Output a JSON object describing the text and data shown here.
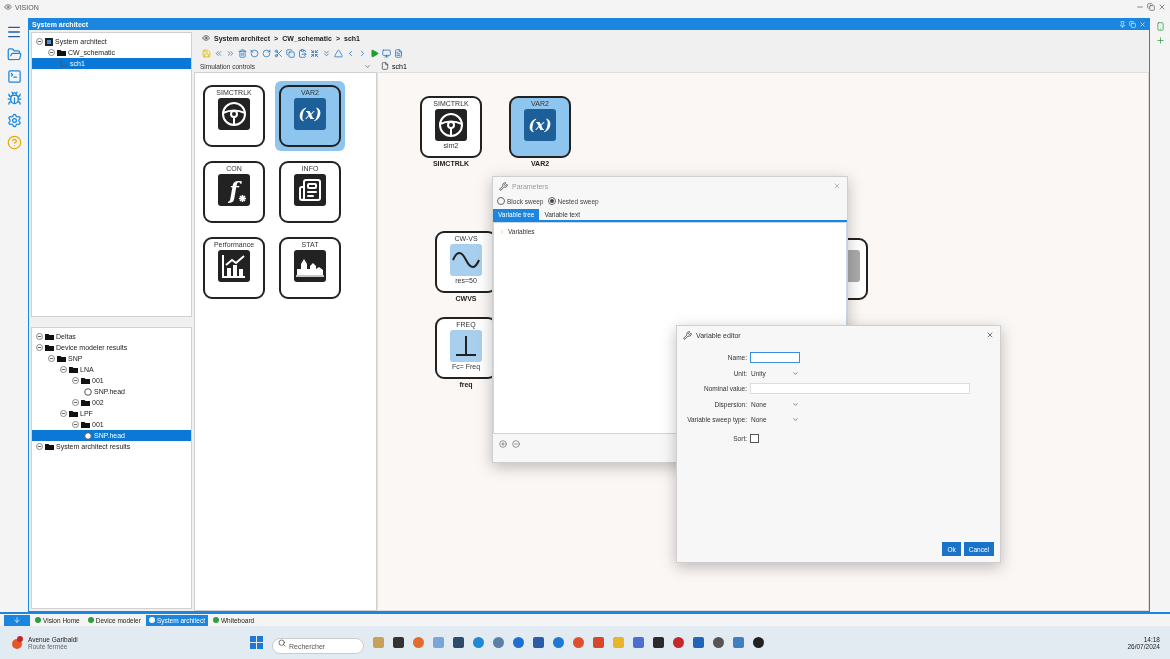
{
  "app": {
    "title": "VISION"
  },
  "window": {
    "title": "System architect"
  },
  "project_tree": [
    {
      "label": "System architect",
      "kind": "project",
      "selected": false,
      "children": [
        {
          "label": "CW_schematic",
          "kind": "folder",
          "selected": false,
          "children": [
            {
              "label": "sch1",
              "kind": "sheet",
              "selected": true
            }
          ]
        }
      ]
    }
  ],
  "results_tree": [
    {
      "label": "Deltas",
      "kind": "folder",
      "selected": false
    },
    {
      "label": "Device modeler results",
      "kind": "folder",
      "selected": false,
      "children": [
        {
          "label": "SNP",
          "kind": "folder",
          "selected": false,
          "children": [
            {
              "label": "LNA",
              "kind": "folder",
              "selected": false,
              "children": [
                {
                  "label": "001",
                  "kind": "folder",
                  "selected": false,
                  "children": [
                    {
                      "label": "SNP.head",
                      "kind": "file",
                      "selected": false
                    }
                  ]
                },
                {
                  "label": "002",
                  "kind": "folder",
                  "selected": false
                }
              ]
            },
            {
              "label": "LPF",
              "kind": "folder",
              "selected": false,
              "children": [
                {
                  "label": "001",
                  "kind": "folder",
                  "selected": false,
                  "children": [
                    {
                      "label": "SNP.head",
                      "kind": "file",
                      "selected": true
                    }
                  ]
                }
              ]
            }
          ]
        }
      ]
    },
    {
      "label": "System architect results",
      "kind": "folder",
      "selected": false
    }
  ],
  "breadcrumb": {
    "items": [
      "System architect",
      "CW_schematic",
      "sch1"
    ],
    "separator": ">"
  },
  "palette": {
    "category": "Simulation controls",
    "items": [
      {
        "label": "SIMCTRLK",
        "kind": "steering",
        "selected": false
      },
      {
        "label": "VAR2",
        "kind": "variable",
        "symbol": "(x)",
        "selected": true
      },
      {
        "label": "CON",
        "kind": "function",
        "symbol": "f",
        "selected": false
      },
      {
        "label": "INFO",
        "kind": "info",
        "selected": false
      },
      {
        "label": "Performance",
        "kind": "chart",
        "selected": false
      },
      {
        "label": "STAT",
        "kind": "stat",
        "selected": false
      }
    ]
  },
  "canvas": {
    "tab": "sch1",
    "nodes": [
      {
        "label": "SIMCTRLK",
        "kind": "steering",
        "param": "sim2",
        "caption": "SIMCTRLK"
      },
      {
        "label": "VAR2",
        "kind": "variable",
        "symbol": "(x)",
        "caption": "VAR2"
      },
      {
        "label": "CW-VS",
        "kind": "sine",
        "param": "res=50",
        "caption": "CWVS"
      },
      {
        "label": "FREQ",
        "kind": "ground",
        "param": "Fc= Freq",
        "caption": "freq"
      }
    ]
  },
  "parameters_dialog": {
    "title": "Parameters",
    "sweep_modes": [
      {
        "label": "Block sweep",
        "selected": false
      },
      {
        "label": "Nested sweep",
        "selected": true
      }
    ],
    "tabs": [
      {
        "label": "Variable tree",
        "selected": true
      },
      {
        "label": "Variable text",
        "selected": false
      }
    ],
    "tree": [
      {
        "label": "Variables"
      }
    ]
  },
  "variable_editor": {
    "title": "Variable editor",
    "fields": [
      {
        "kind": "short_text",
        "label": "Name:",
        "focused": true
      },
      {
        "kind": "select",
        "label": "Unit:",
        "value": "Unity",
        "focused": false
      },
      {
        "kind": "long_text",
        "label": "Nominal value:",
        "focused": false
      },
      {
        "kind": "select",
        "label": "Dispersion:",
        "value": "None",
        "focused": false
      },
      {
        "kind": "select",
        "label": "Variable sweep type:",
        "value": "None",
        "focused": false
      },
      {
        "kind": "checkbox",
        "label": "Sort:",
        "checked": false,
        "focused": false
      }
    ],
    "buttons": [
      "Ok",
      "Cancel"
    ]
  },
  "bottom_tabs": [
    {
      "label": "Vision Home",
      "selected": false
    },
    {
      "label": "Device modeler",
      "selected": false
    },
    {
      "label": "System architect",
      "selected": true
    },
    {
      "label": "Whiteboard",
      "selected": false
    }
  ],
  "taskbar": {
    "weather": {
      "title": "Avenue Garibaldi",
      "subtitle": "Route fermée"
    },
    "search": {
      "placeholder": "Rechercher"
    },
    "clock": {
      "time": "14:18",
      "date": "26/07/2024"
    }
  }
}
